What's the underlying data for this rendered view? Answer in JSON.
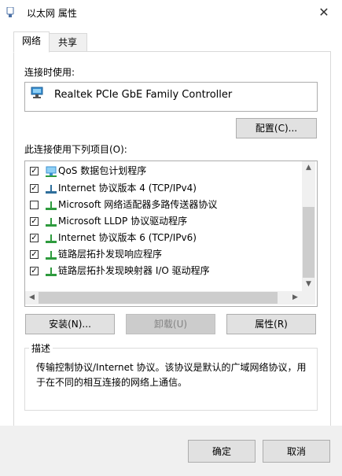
{
  "window": {
    "title": "以太网 属性",
    "close_glyph": "✕"
  },
  "tabs": [
    {
      "label": "网络",
      "active": true
    },
    {
      "label": "共享",
      "active": false
    }
  ],
  "connect_using_label": "连接时使用:",
  "adapter_name": "Realtek PCIe GbE Family Controller",
  "configure_button": "配置(C)...",
  "items_label": "此连接使用下列项目(O):",
  "items": [
    {
      "label": "QoS 数据包计划程序",
      "checked": true,
      "icon": "qos-icon"
    },
    {
      "label": "Internet 协议版本 4 (TCP/IPv4)",
      "checked": true,
      "icon": "protocol-icon"
    },
    {
      "label": "Microsoft 网络适配器多路传送器协议",
      "checked": false,
      "icon": "protocol-icon"
    },
    {
      "label": "Microsoft LLDP 协议驱动程序",
      "checked": true,
      "icon": "protocol-icon"
    },
    {
      "label": "Internet 协议版本 6 (TCP/IPv6)",
      "checked": true,
      "icon": "protocol-icon"
    },
    {
      "label": "链路层拓扑发现响应程序",
      "checked": true,
      "icon": "protocol-icon"
    },
    {
      "label": "链路层拓扑发现映射器 I/O 驱动程序",
      "checked": true,
      "icon": "protocol-icon"
    }
  ],
  "scroll": {
    "up": "▲",
    "down": "▼",
    "left": "◀",
    "right": "▶"
  },
  "install_button": "安装(N)...",
  "uninstall_button": "卸载(U)",
  "properties_button": "属性(R)",
  "description": {
    "title": "描述",
    "text": "传输控制协议/Internet 协议。该协议是默认的广域网络协议，用于在不同的相互连接的网络上通信。"
  },
  "ok_button": "确定",
  "cancel_button": "取消",
  "colors": {
    "protocol_icon": "#2e9b3e",
    "adapter_icon": "#3a8fd0",
    "bottom_bar": "#f0f0f0"
  }
}
